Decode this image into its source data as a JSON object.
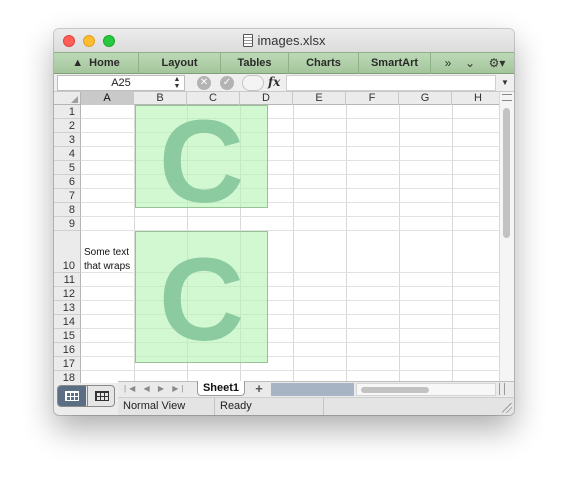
{
  "window": {
    "title": "images.xlsx"
  },
  "ribbon": {
    "tabs": [
      "Home",
      "Layout",
      "Tables",
      "Charts",
      "SmartArt"
    ],
    "overflow_glyph": "»",
    "collapse_glyph": "⌄",
    "settings_glyph": "⚙▾"
  },
  "formula_bar": {
    "name_box": "A25",
    "fx_label": "fx",
    "formula": ""
  },
  "columns": [
    "A",
    "B",
    "C",
    "D",
    "E",
    "F",
    "G",
    "H"
  ],
  "selected_column": "A",
  "rows": [
    "1",
    "2",
    "3",
    "4",
    "5",
    "6",
    "7",
    "8",
    "9",
    "10",
    "11",
    "12",
    "13",
    "14",
    "15",
    "16",
    "17",
    "18"
  ],
  "cells": {
    "A10": "Some text that wraps"
  },
  "images": [
    {
      "letter": "C",
      "color": "#b4f4b4"
    },
    {
      "letter": "C",
      "color": "#b4f4b4"
    }
  ],
  "sheets": {
    "nav_glyphs": "|◀ ◀ ▶ ▶|",
    "tabs": [
      "Sheet1"
    ],
    "add_label": "+"
  },
  "status": {
    "view": "Normal View",
    "state": "Ready"
  }
}
